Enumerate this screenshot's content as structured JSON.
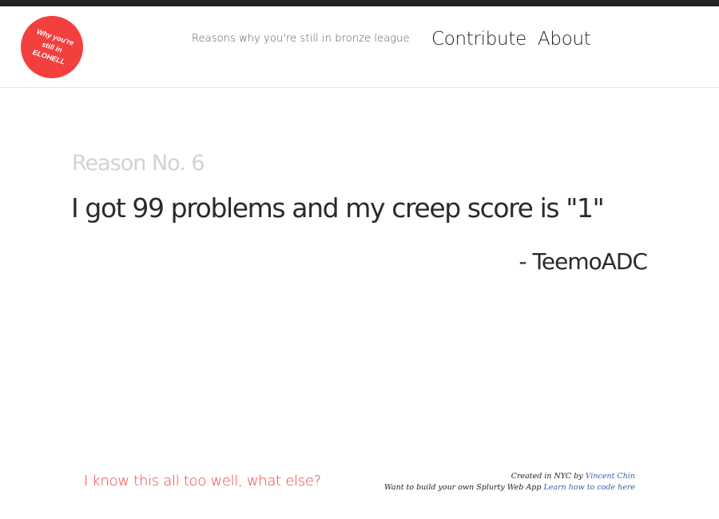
{
  "header": {
    "logo_text": "Why you're still in ELOHELL",
    "tagline": "Reasons why you're still in bronze league",
    "nav": {
      "contribute": "Contribute",
      "about": "About"
    }
  },
  "reason": {
    "label": "Reason No. 6",
    "text": "I got 99 problems and my creep score is \"1\"",
    "author": "- TeemoADC"
  },
  "footer": {
    "next_link": "I know this all too well, what else?",
    "credit_prefix": "Created in NYC by",
    "credit_author": "Vincent Chin",
    "build_prefix": "Want to build your own Splurty Web App",
    "build_link": "Learn how to code here"
  },
  "colors": {
    "accent": "#f2403f",
    "topbar": "#222222",
    "muted": "#d2d2d2",
    "link": "#3a5ea8"
  }
}
